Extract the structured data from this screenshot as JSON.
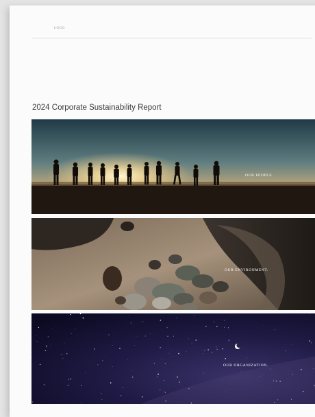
{
  "header": {
    "logo_text": "LOGO"
  },
  "report": {
    "title": "2024 Corporate Sustainability Report"
  },
  "sections": [
    {
      "caption": "OUR PEOPLE."
    },
    {
      "caption": "OUR ENVIRONMENT."
    },
    {
      "caption": "OUR ORGANIZATION."
    }
  ]
}
